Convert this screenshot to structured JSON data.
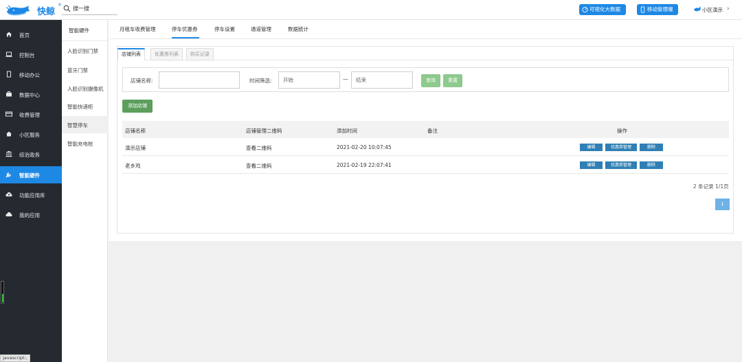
{
  "header": {
    "logo_text": "快鲸",
    "logo_reg": "®",
    "search_placeholder": "搜一搜",
    "visual_btn": "可视化大数据",
    "mobile_btn": "移动管理端",
    "community": "小区演示",
    "chevron": "›",
    "accent": "#1e88e5"
  },
  "sidebar": {
    "items": [
      {
        "label": "首页",
        "icon": "home-icon"
      },
      {
        "label": "控制台",
        "icon": "laptop-icon"
      },
      {
        "label": "移动办公",
        "icon": "mobile-icon"
      },
      {
        "label": "数据中心",
        "icon": "briefcase-icon"
      },
      {
        "label": "收费管理",
        "icon": "card-icon"
      },
      {
        "label": "小区服务",
        "icon": "house-icon"
      },
      {
        "label": "综治政务",
        "icon": "bank-icon"
      },
      {
        "label": "智能硬件",
        "icon": "wrench-icon"
      },
      {
        "label": "功能应用库",
        "icon": "cloud-upload-icon"
      },
      {
        "label": "我的应用",
        "icon": "cloud-icon"
      }
    ],
    "active": "智能硬件",
    "status_link": "javascript:;"
  },
  "subnav": {
    "title": "智能硬件",
    "items": [
      "人脸识别门禁",
      "蓝牙门禁",
      "人脸识别摄像机",
      "智能快递柜",
      "智慧停车",
      "智能充电桩"
    ],
    "active": "智慧停车"
  },
  "top_tabs": [
    "月租车收费管理",
    "停车优惠券",
    "停车设置",
    "通道管理",
    "数据统计"
  ],
  "top_tab_active": "停车优惠券",
  "inner_tabs": [
    "店铺列表",
    "优惠券列表",
    "购买记录"
  ],
  "inner_tab_active": "店铺列表",
  "filter": {
    "shop_label": "店铺名称:",
    "shop_value": "",
    "time_label": "时间筛选:",
    "start_placeholder": "开始",
    "end_placeholder": "结束",
    "dash": "—",
    "query_btn": "查询",
    "reset_btn": "重置"
  },
  "add_btn": "添加店铺",
  "table": {
    "headers": [
      "店铺名称",
      "店铺管理二维码",
      "添加时间",
      "备注",
      "操作"
    ],
    "rows": [
      {
        "name": "演示店铺",
        "qr": "查看二维码",
        "time": "2021-02-20 10:07:45",
        "note": ""
      },
      {
        "name": "老乡鸡",
        "qr": "查看二维码",
        "time": "2021-02-19 22:07:41",
        "note": ""
      }
    ],
    "actions": [
      "编辑",
      "优惠券管理",
      "删除"
    ]
  },
  "pager": {
    "info": "2 条记录 1/1页",
    "page": "1"
  }
}
